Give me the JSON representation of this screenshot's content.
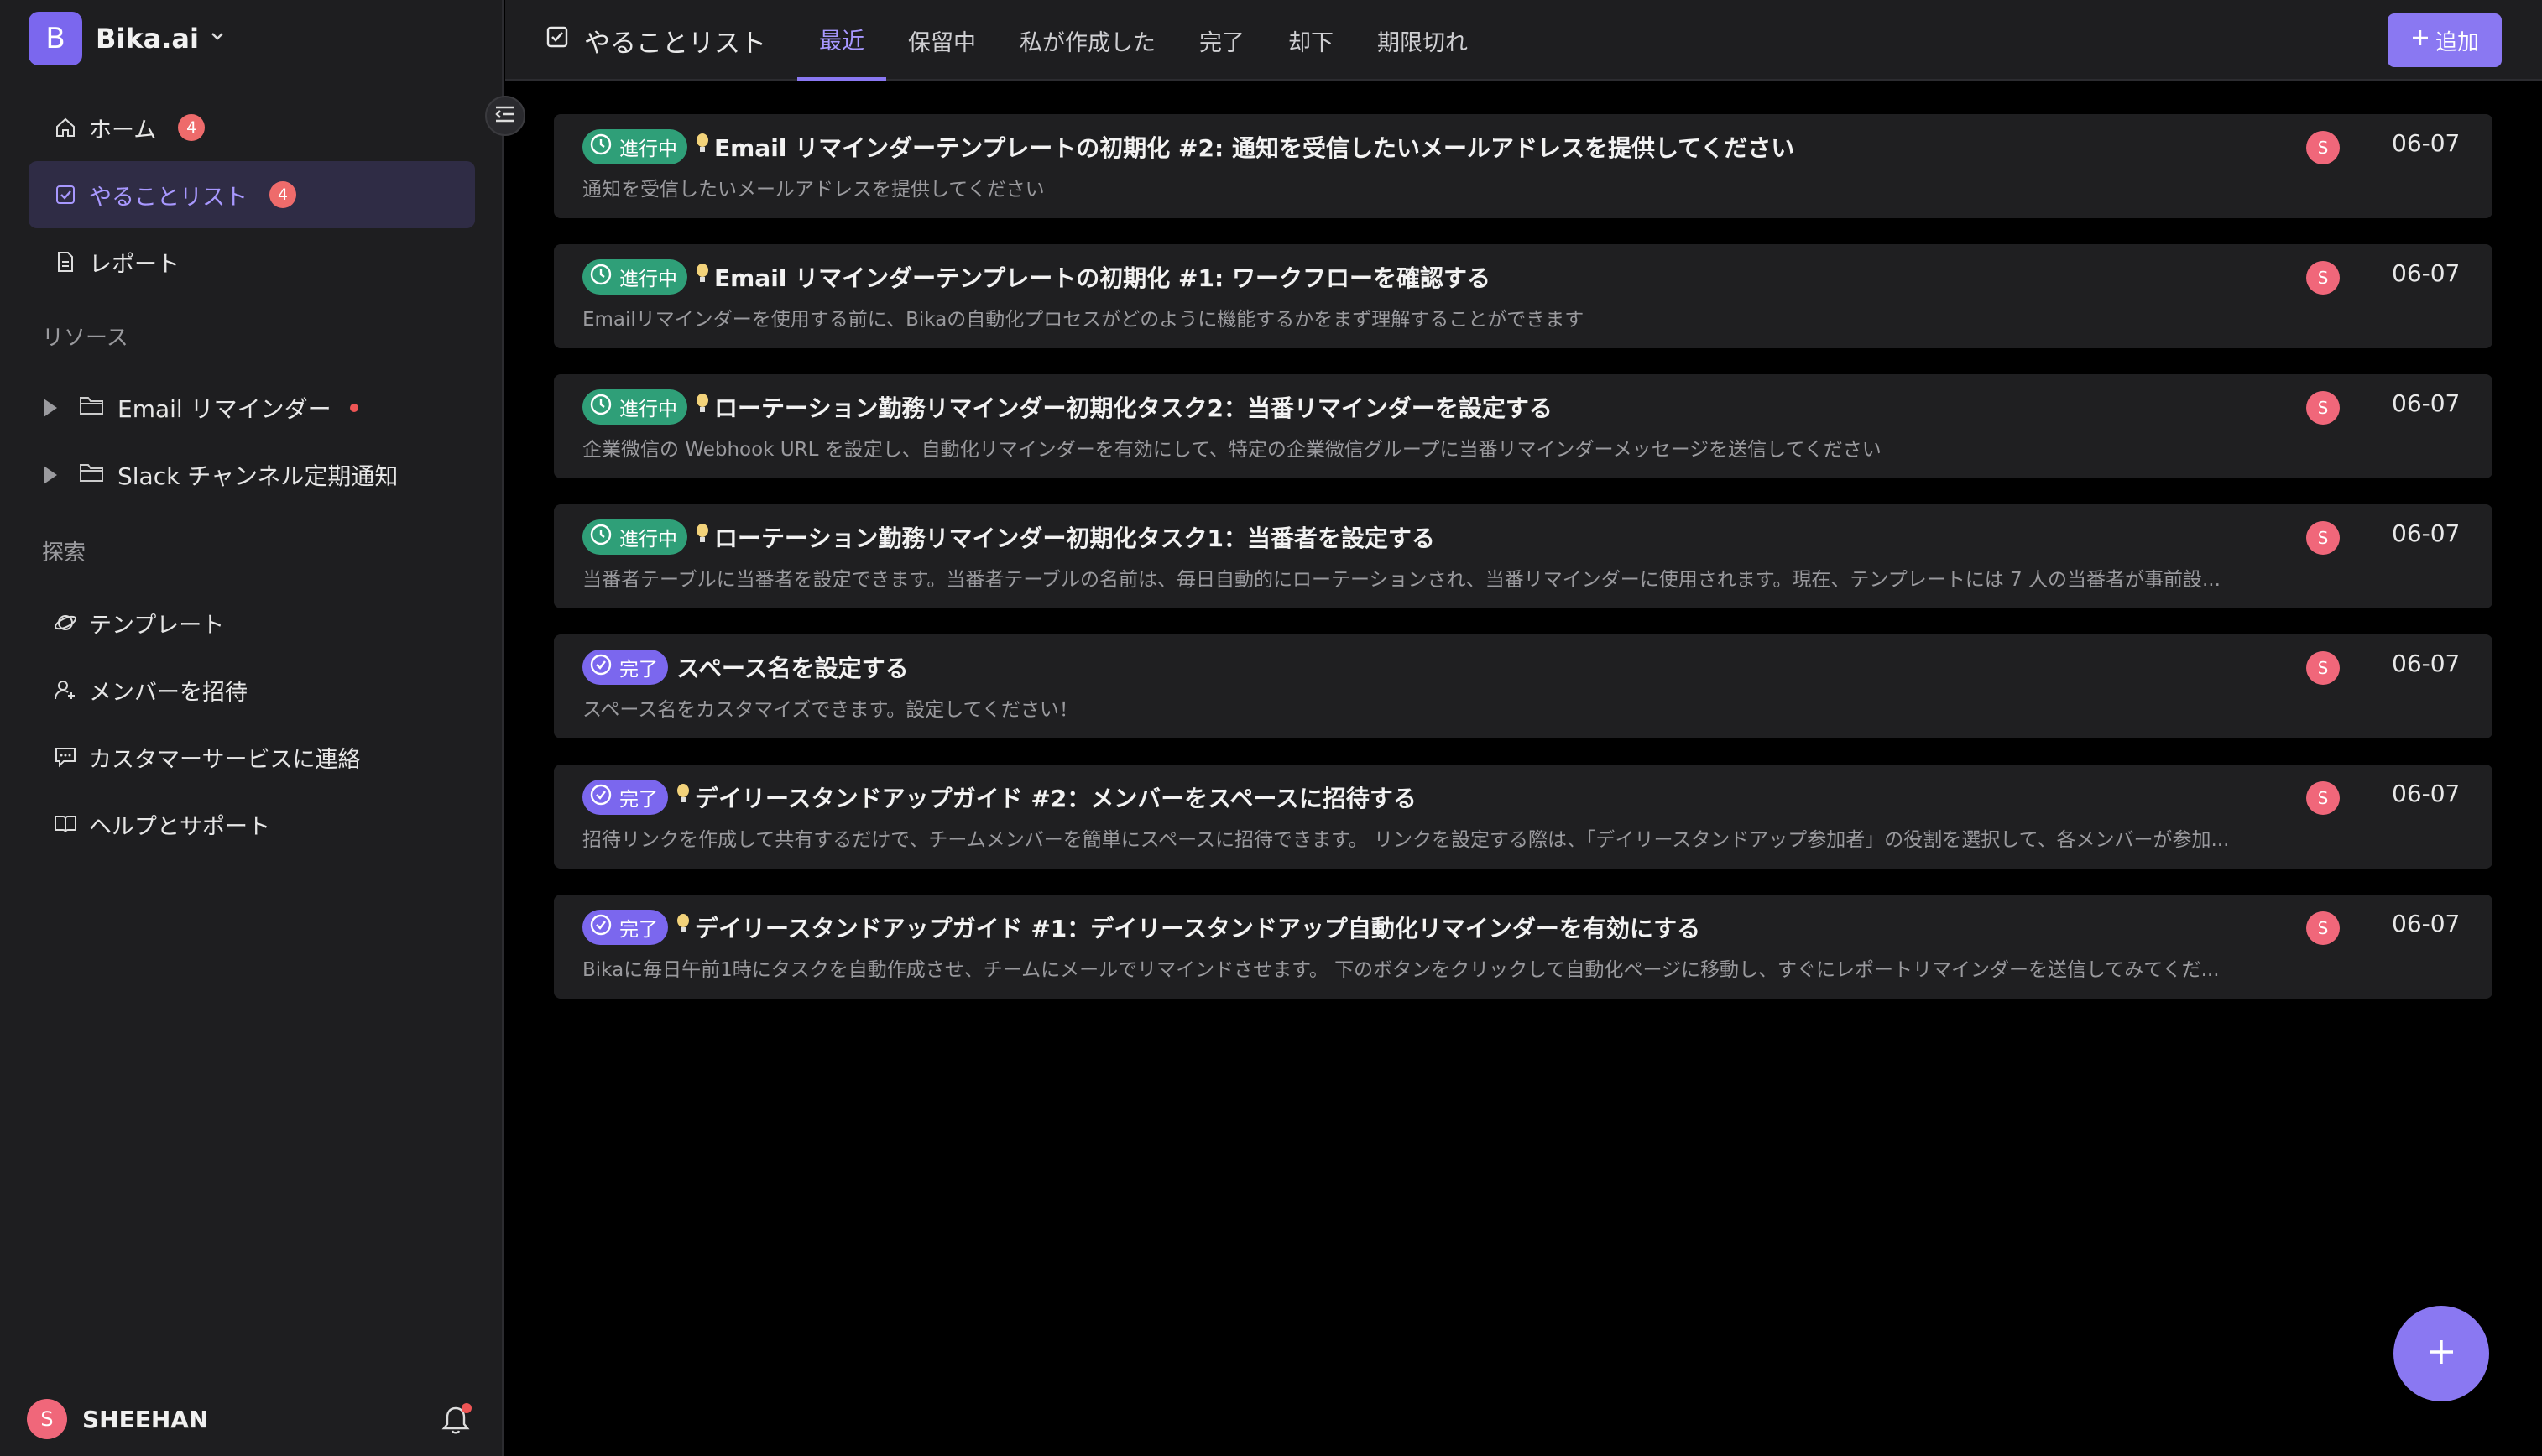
{
  "sidebar": {
    "brand": {
      "initial": "B",
      "name": "Bika.ai"
    },
    "nav": [
      {
        "label": "ホーム",
        "badge": "4",
        "icon": "home-icon"
      },
      {
        "label": "やることリスト",
        "badge": "4",
        "icon": "checkbox-icon",
        "active": true
      },
      {
        "label": "レポート",
        "badge": "",
        "icon": "document-icon"
      }
    ],
    "resources_label": "リソース",
    "resources": [
      {
        "label": "Email リマインダー",
        "icon": "folder-icon",
        "dot": true
      },
      {
        "label": "Slack チャンネル定期通知",
        "icon": "folder-icon",
        "dot": false
      }
    ],
    "explore_label": "探索",
    "explore": [
      {
        "label": "テンプレート",
        "icon": "planet-icon"
      },
      {
        "label": "メンバーを招待",
        "icon": "user-add-icon"
      },
      {
        "label": "カスタマーサービスに連絡",
        "icon": "chat-icon"
      },
      {
        "label": "ヘルプとサポート",
        "icon": "book-icon"
      }
    ],
    "user": {
      "initial": "S",
      "name": "SHEEHAN"
    }
  },
  "topbar": {
    "title": "やることリスト",
    "tabs": [
      "最近",
      "保留中",
      "私が作成した",
      "完了",
      "却下",
      "期限切れ"
    ],
    "active_tab": 0,
    "add_label": "追加"
  },
  "tasks": [
    {
      "status": "進行中",
      "status_type": "progress",
      "bulb": true,
      "title": "Email リマインダーテンプレートの初期化 #2: 通知を受信したいメールアドレスを提供してください",
      "desc": "通知を受信したいメールアドレスを提供してください",
      "assignee": "S",
      "date": "06-07"
    },
    {
      "status": "進行中",
      "status_type": "progress",
      "bulb": true,
      "title": "Email リマインダーテンプレートの初期化 #1: ワークフローを確認する",
      "desc": "Emailリマインダーを使用する前に、Bikaの自動化プロセスがどのように機能するかをまず理解することができます",
      "assignee": "S",
      "date": "06-07"
    },
    {
      "status": "進行中",
      "status_type": "progress",
      "bulb": true,
      "title": "ローテーション勤務リマインダー初期化タスク2：当番リマインダーを設定する",
      "desc": "企業微信の Webhook URL を設定し、自動化リマインダーを有効にして、特定の企業微信グループに当番リマインダーメッセージを送信してください",
      "assignee": "S",
      "date": "06-07"
    },
    {
      "status": "進行中",
      "status_type": "progress",
      "bulb": true,
      "title": "ローテーション勤務リマインダー初期化タスク1：当番者を設定する",
      "desc": "当番者テーブルに当番者を設定できます。当番者テーブルの名前は、毎日自動的にローテーションされ、当番リマインダーに使用されます。現在、テンプレートには 7 人の当番者が事前設...",
      "assignee": "S",
      "date": "06-07"
    },
    {
      "status": "完了",
      "status_type": "done",
      "bulb": false,
      "title": "スペース名を設定する",
      "desc": "スペース名をカスタマイズできます。設定してください！",
      "assignee": "S",
      "date": "06-07"
    },
    {
      "status": "完了",
      "status_type": "done",
      "bulb": true,
      "title": "デイリースタンドアップガイド #2：メンバーをスペースに招待する",
      "desc": "招待リンクを作成して共有するだけで、チームメンバーを簡単にスペースに招待できます。 リンクを設定する際は、「デイリースタンドアップ参加者」の役割を選択して、各メンバーが参加...",
      "assignee": "S",
      "date": "06-07"
    },
    {
      "status": "完了",
      "status_type": "done",
      "bulb": true,
      "title": "デイリースタンドアップガイド #1：デイリースタンドアップ自動化リマインダーを有効にする",
      "desc": "Bikaに毎日午前1時にタスクを自動作成させ、チームにメールでリマインドさせます。 下のボタンをクリックして自動化ページに移動し、すぐにレポートリマインダーを送信してみてくだ...",
      "assignee": "S",
      "date": "06-07"
    }
  ],
  "colors": {
    "accent": "#8a78f2",
    "progress": "#2f9f78",
    "badge": "#ee6b6b",
    "avatar": "#f0677a"
  }
}
